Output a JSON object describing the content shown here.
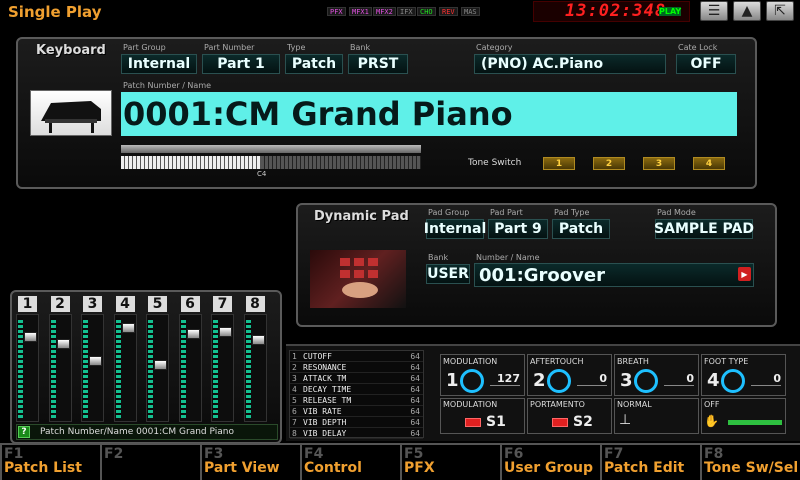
{
  "app": {
    "title": "Single Play"
  },
  "fx_indicators": [
    "PFX",
    "MFX1",
    "MFX2",
    "IFX",
    "CHO",
    "REV",
    "MAS"
  ],
  "fx_colors": [
    "#e050e0",
    "#e050e0",
    "#e050e0",
    "#888",
    "#20e020",
    "#ff3030",
    "#888"
  ],
  "clock": {
    "time": "13:02:348",
    "status": "PLAY"
  },
  "keyboard_panel": {
    "title": "Keyboard",
    "part_group": {
      "label": "Part Group",
      "value": "Internal"
    },
    "part_number": {
      "label": "Part Number",
      "value": "Part 1"
    },
    "type": {
      "label": "Type",
      "value": "Patch"
    },
    "bank": {
      "label": "Bank",
      "value": "PRST"
    },
    "category": {
      "label": "Category",
      "value": "(PNO) AC.Piano"
    },
    "cate_lock": {
      "label": "Cate Lock",
      "value": "OFF"
    },
    "patch_label": "Patch Number / Name",
    "patch_name": "0001:CM Grand Piano",
    "key_marker": "C4",
    "tone_switch": {
      "label": "Tone Switch",
      "buttons": [
        "1",
        "2",
        "3",
        "4"
      ]
    }
  },
  "pad_panel": {
    "title": "Dynamic Pad",
    "pad_group": {
      "label": "Pad Group",
      "value": "Internal"
    },
    "pad_part": {
      "label": "Pad Part",
      "value": "Part 9"
    },
    "pad_type": {
      "label": "Pad Type",
      "value": "Patch"
    },
    "pad_mode": {
      "label": "Pad Mode",
      "value": "SAMPLE PAD"
    },
    "bank": {
      "label": "Bank",
      "value": "USER"
    },
    "name": {
      "label": "Number / Name",
      "value": "001:Groover"
    }
  },
  "mixer": {
    "channels": [
      "1",
      "2",
      "3",
      "4",
      "5",
      "6",
      "7",
      "8"
    ],
    "levels": [
      0.85,
      0.78,
      0.6,
      0.95,
      0.55,
      0.88,
      0.9,
      0.82
    ],
    "status_text": "Patch Number/Name 0001:CM Grand Piano",
    "help_icon": "?"
  },
  "params": [
    {
      "n": "1",
      "name": "CUTOFF",
      "value": "64"
    },
    {
      "n": "2",
      "name": "RESONANCE",
      "value": "64"
    },
    {
      "n": "3",
      "name": "ATTACK TM",
      "value": "64"
    },
    {
      "n": "4",
      "name": "DECAY TIME",
      "value": "64"
    },
    {
      "n": "5",
      "name": "RELEASE TM",
      "value": "64"
    },
    {
      "n": "6",
      "name": "VIB RATE",
      "value": "64"
    },
    {
      "n": "7",
      "name": "VIB DEPTH",
      "value": "64"
    },
    {
      "n": "8",
      "name": "VIB DELAY",
      "value": "64"
    }
  ],
  "controls": {
    "modulation": {
      "label": "MODULATION",
      "num": "1",
      "value": "127"
    },
    "aftertouch": {
      "label": "AFTERTOUCH",
      "num": "2",
      "value": "0"
    },
    "breath": {
      "label": "BREATH",
      "num": "3",
      "value": "0"
    },
    "foot_type": {
      "label": "FOOT TYPE",
      "num": "4",
      "value": "0"
    },
    "s1": {
      "label": "MODULATION",
      "btn": "S1"
    },
    "s2": {
      "label": "PORTAMENTO",
      "btn": "S2"
    },
    "normal": {
      "label": "NORMAL"
    },
    "off": {
      "label": "OFF"
    }
  },
  "function_keys": [
    {
      "num": "F1",
      "label": "Patch List"
    },
    {
      "num": "F2",
      "label": ""
    },
    {
      "num": "F3",
      "label": "Part View"
    },
    {
      "num": "F4",
      "label": "Control"
    },
    {
      "num": "F5",
      "label": "PFX"
    },
    {
      "num": "F6",
      "label": "User Group"
    },
    {
      "num": "F7",
      "label": "Patch Edit"
    },
    {
      "num": "F8",
      "label": "Tone Sw/Sel"
    }
  ]
}
